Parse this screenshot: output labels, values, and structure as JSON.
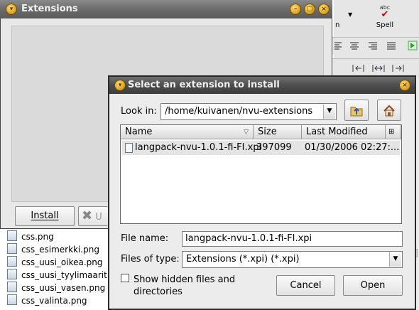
{
  "background_app": {
    "toolbar": {
      "spell_icon_text": "abc",
      "spell_label": "Spell",
      "cut_off_label": "n"
    },
    "file_list": [
      {
        "name": "css.png"
      },
      {
        "name": "css_esimerkki.png"
      },
      {
        "name": "css_uusi_oikea.png"
      },
      {
        "name": "css_uusi_tyylimaarit"
      },
      {
        "name": "css_uusi_vasen.png"
      },
      {
        "name": "css_valinta.png"
      }
    ]
  },
  "extensions_window": {
    "title": "Extensions",
    "install_label": "Install",
    "uninstall_partial_label": "U"
  },
  "select_dialog": {
    "title": "Select an extension to install",
    "look_in_label": "Look in:",
    "look_in_value": "/home/kuivanen/nvu-extensions",
    "columns": {
      "name": "Name",
      "size": "Size",
      "modified": "Last Modified"
    },
    "files": [
      {
        "name": "langpack-nvu-1.0.1-fi-FI.xpi",
        "size": "397099",
        "modified": "01/30/2006 02:27:..."
      }
    ],
    "file_name_label": "File name:",
    "file_name_value": "langpack-nvu-1.0.1-fi-FI.xpi",
    "file_type_label": "Files of type:",
    "file_type_value": "Extensions (*.xpi) (*.xpi)",
    "show_hidden_label_line1": "Show hidden files and",
    "show_hidden_label_line2": "directories",
    "show_hidden_checked": false,
    "cancel_label": "Cancel",
    "open_label": "Open"
  },
  "colors": {
    "title_bar": "#5a5a5a",
    "button_gold": "#d69a18",
    "selection_row": "#e4e4e4",
    "spell_check": "#cc0000"
  }
}
